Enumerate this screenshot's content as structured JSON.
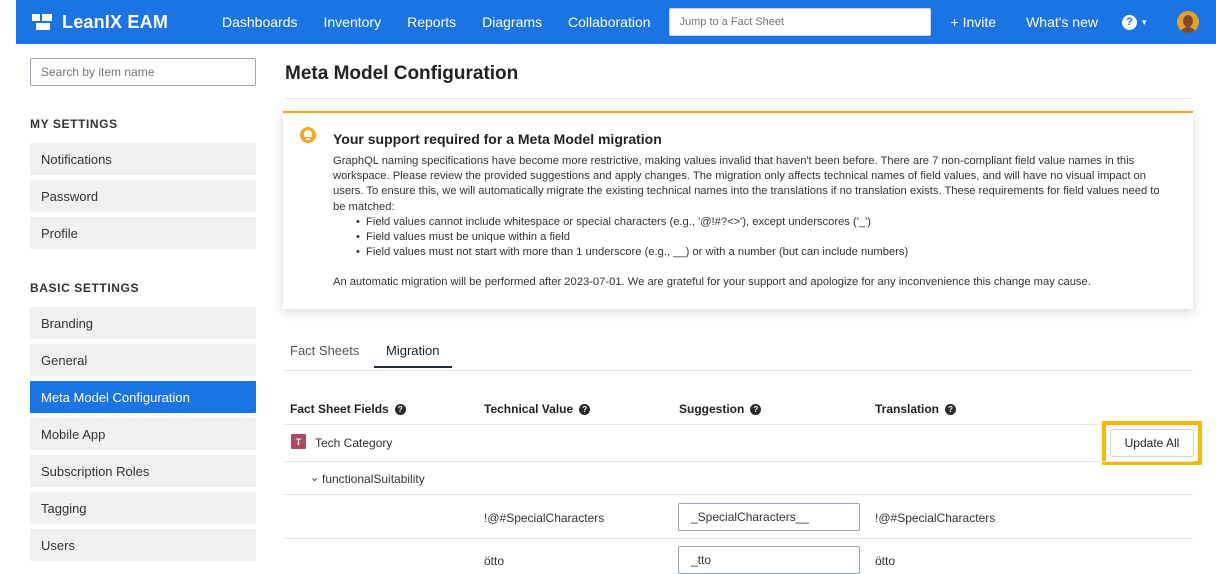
{
  "topbar": {
    "brand": "LeanIX EAM",
    "nav": [
      "Dashboards",
      "Inventory",
      "Reports",
      "Diagrams",
      "Collaboration"
    ],
    "jump_placeholder": "Jump to a Fact Sheet",
    "invite": "+ Invite",
    "whats_new": "What's new",
    "help_glyph": "?",
    "caret_glyph": "▾"
  },
  "sidebar": {
    "search_placeholder": "Search by item name",
    "my_settings_title": "MY SETTINGS",
    "my_settings": [
      "Notifications",
      "Password",
      "Profile"
    ],
    "basic_settings_title": "BASIC SETTINGS",
    "basic_settings": [
      "Branding",
      "General",
      "Meta Model Configuration",
      "Mobile App",
      "Subscription Roles",
      "Tagging",
      "Users"
    ],
    "active_item": "Meta Model Configuration"
  },
  "main": {
    "title": "Meta Model Configuration",
    "alert": {
      "title": "Your support required for a Meta Model migration",
      "body": "GraphQL naming specifications have become more restrictive, making values invalid that haven't been before. There are 7 non-compliant field value names in this workspace. Please review the provided suggestions and apply changes. The migration only affects technical names of field values, and will have no visual impact on users. To ensure this, we will automatically migrate the existing technical names into the translations if no translation exists. These requirements for field values need to be matched:",
      "rules": [
        "Field values cannot include whitespace or special characters (e.g., '@!#?<>'), except underscores ('_')",
        "Field values must be unique within a field",
        "Field values must not start with more than 1 underscore (e.g., __) or with a number (but can include numbers)"
      ],
      "footer": "An automatic migration will be performed after 2023-07-01. We are grateful for your support and apologize for any inconvenience this change may cause."
    },
    "tabs": [
      "Fact Sheets",
      "Migration"
    ],
    "active_tab": "Migration",
    "table": {
      "headers": [
        "Fact Sheet Fields",
        "Technical Value",
        "Suggestion",
        "Translation"
      ],
      "help_glyph": "?",
      "group_badge": "T",
      "group_name": "Tech Category",
      "update_all": "Update All",
      "field_name": "functionalSuitability",
      "field_chevron": "⌄",
      "rows": [
        {
          "technical": "!@#SpecialCharacters",
          "suggestion": "_SpecialCharacters__",
          "translation": "!@#SpecialCharacters"
        },
        {
          "technical": "ötto",
          "suggestion": "_tto",
          "translation": "ötto"
        }
      ]
    }
  },
  "colors": {
    "brand_blue": "#1b74e4",
    "alert_orange": "#f5a623",
    "highlight_yellow": "#f7b800",
    "tech_badge": "#b0485f"
  }
}
